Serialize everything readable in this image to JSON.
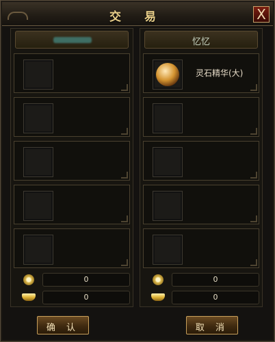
{
  "title": "交 易",
  "close_label": "X",
  "left": {
    "name": "",
    "slots": [
      {
        "item": null
      },
      {
        "item": null
      },
      {
        "item": null
      },
      {
        "item": null
      },
      {
        "item": null
      }
    ],
    "gold": "0",
    "yuanbao": "0"
  },
  "right": {
    "name": "忆忆",
    "slots": [
      {
        "item": "灵石精华(大)"
      },
      {
        "item": null
      },
      {
        "item": null
      },
      {
        "item": null
      },
      {
        "item": null
      }
    ],
    "gold": "0",
    "yuanbao": "0"
  },
  "buttons": {
    "confirm": "确 认",
    "cancel": "取 消"
  },
  "colors": {
    "gold_text": "#e9cf8a",
    "frame": "#5b4f3d",
    "button_border": "#c8a05c"
  },
  "icons": {
    "gold": "coin-icon",
    "yuanbao": "gold-ingot-icon",
    "item": "spirit-stone-essence-icon"
  }
}
